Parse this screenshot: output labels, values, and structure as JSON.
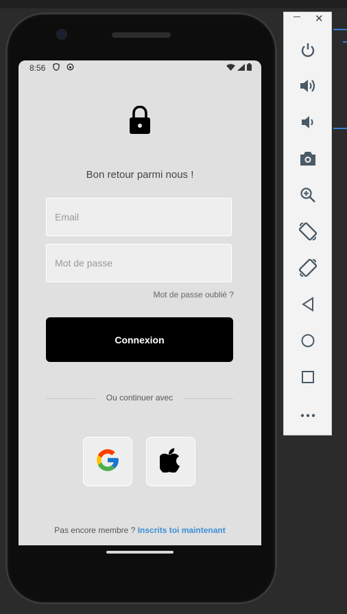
{
  "status_bar": {
    "time": "8:56"
  },
  "login": {
    "welcome": "Bon retour parmi nous !",
    "email_placeholder": "Email",
    "password_placeholder": "Mot de passe",
    "forgot_password": "Mot de passe oublié ?",
    "login_button": "Connexion",
    "divider_text": "Ou continuer avec",
    "signup_prompt": "Pas encore membre ?",
    "signup_link": "Inscrits toi maintenant"
  },
  "social_logins": [
    {
      "name": "google",
      "icon": "google-icon"
    },
    {
      "name": "apple",
      "icon": "apple-icon"
    }
  ],
  "emulator_toolbar": {
    "buttons": [
      "power",
      "volume-up",
      "volume-down",
      "screenshot",
      "zoom",
      "rotate-left",
      "rotate-right",
      "back",
      "home",
      "overview",
      "more"
    ]
  },
  "colors": {
    "screen_bg": "#e0e0e0",
    "field_bg": "#eeeeee",
    "button_bg": "#000000",
    "link": "#3d8fd6"
  }
}
